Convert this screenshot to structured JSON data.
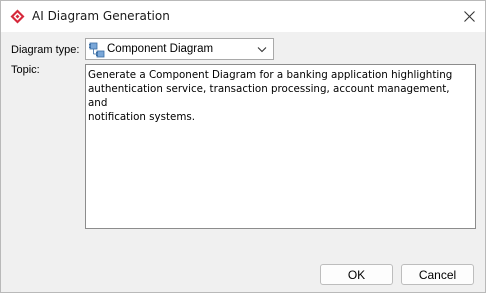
{
  "window": {
    "title": "AI Diagram Generation",
    "app_icon": "red-diamond-icon",
    "close_icon": "close-icon"
  },
  "form": {
    "diagram_type_label": "Diagram type:",
    "diagram_type_value": "Component Diagram",
    "diagram_type_icon": "component-diagram-icon",
    "topic_label": "Topic:",
    "topic_value": "Generate a Component Diagram for a banking application highlighting\nauthentication service, transaction processing, account management, and\nnotification systems."
  },
  "buttons": {
    "ok_label": "OK",
    "cancel_label": "Cancel"
  },
  "colors": {
    "accent": "#d6283a",
    "window_bg": "#f0f0f0",
    "titlebar_bg": "#ffffff",
    "field_bg": "#ffffff"
  }
}
